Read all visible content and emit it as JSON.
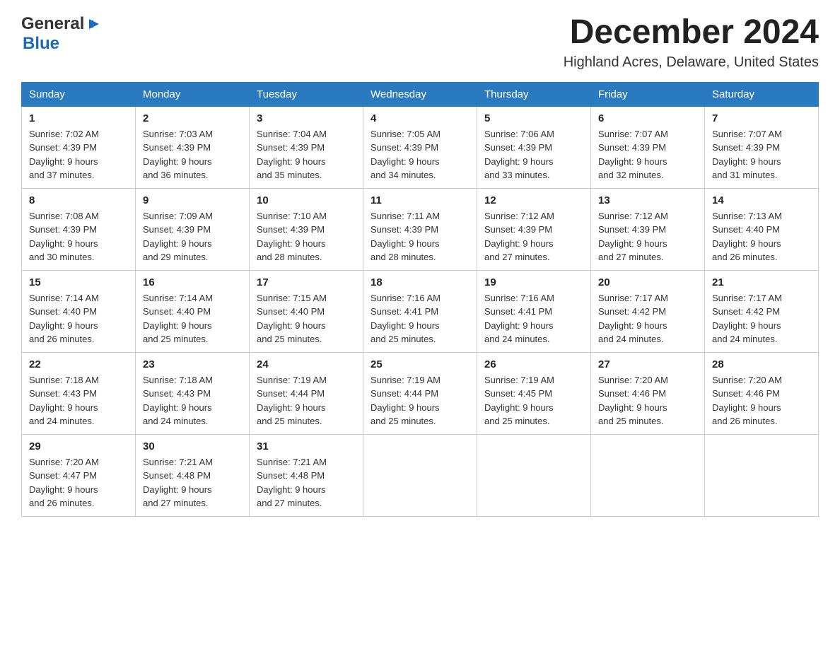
{
  "logo": {
    "general": "General",
    "blue": "Blue"
  },
  "title": "December 2024",
  "location": "Highland Acres, Delaware, United States",
  "weekdays": [
    "Sunday",
    "Monday",
    "Tuesday",
    "Wednesday",
    "Thursday",
    "Friday",
    "Saturday"
  ],
  "weeks": [
    [
      {
        "day": "1",
        "sunrise": "7:02 AM",
        "sunset": "4:39 PM",
        "daylight": "9 hours and 37 minutes."
      },
      {
        "day": "2",
        "sunrise": "7:03 AM",
        "sunset": "4:39 PM",
        "daylight": "9 hours and 36 minutes."
      },
      {
        "day": "3",
        "sunrise": "7:04 AM",
        "sunset": "4:39 PM",
        "daylight": "9 hours and 35 minutes."
      },
      {
        "day": "4",
        "sunrise": "7:05 AM",
        "sunset": "4:39 PM",
        "daylight": "9 hours and 34 minutes."
      },
      {
        "day": "5",
        "sunrise": "7:06 AM",
        "sunset": "4:39 PM",
        "daylight": "9 hours and 33 minutes."
      },
      {
        "day": "6",
        "sunrise": "7:07 AM",
        "sunset": "4:39 PM",
        "daylight": "9 hours and 32 minutes."
      },
      {
        "day": "7",
        "sunrise": "7:07 AM",
        "sunset": "4:39 PM",
        "daylight": "9 hours and 31 minutes."
      }
    ],
    [
      {
        "day": "8",
        "sunrise": "7:08 AM",
        "sunset": "4:39 PM",
        "daylight": "9 hours and 30 minutes."
      },
      {
        "day": "9",
        "sunrise": "7:09 AM",
        "sunset": "4:39 PM",
        "daylight": "9 hours and 29 minutes."
      },
      {
        "day": "10",
        "sunrise": "7:10 AM",
        "sunset": "4:39 PM",
        "daylight": "9 hours and 28 minutes."
      },
      {
        "day": "11",
        "sunrise": "7:11 AM",
        "sunset": "4:39 PM",
        "daylight": "9 hours and 28 minutes."
      },
      {
        "day": "12",
        "sunrise": "7:12 AM",
        "sunset": "4:39 PM",
        "daylight": "9 hours and 27 minutes."
      },
      {
        "day": "13",
        "sunrise": "7:12 AM",
        "sunset": "4:39 PM",
        "daylight": "9 hours and 27 minutes."
      },
      {
        "day": "14",
        "sunrise": "7:13 AM",
        "sunset": "4:40 PM",
        "daylight": "9 hours and 26 minutes."
      }
    ],
    [
      {
        "day": "15",
        "sunrise": "7:14 AM",
        "sunset": "4:40 PM",
        "daylight": "9 hours and 26 minutes."
      },
      {
        "day": "16",
        "sunrise": "7:14 AM",
        "sunset": "4:40 PM",
        "daylight": "9 hours and 25 minutes."
      },
      {
        "day": "17",
        "sunrise": "7:15 AM",
        "sunset": "4:40 PM",
        "daylight": "9 hours and 25 minutes."
      },
      {
        "day": "18",
        "sunrise": "7:16 AM",
        "sunset": "4:41 PM",
        "daylight": "9 hours and 25 minutes."
      },
      {
        "day": "19",
        "sunrise": "7:16 AM",
        "sunset": "4:41 PM",
        "daylight": "9 hours and 24 minutes."
      },
      {
        "day": "20",
        "sunrise": "7:17 AM",
        "sunset": "4:42 PM",
        "daylight": "9 hours and 24 minutes."
      },
      {
        "day": "21",
        "sunrise": "7:17 AM",
        "sunset": "4:42 PM",
        "daylight": "9 hours and 24 minutes."
      }
    ],
    [
      {
        "day": "22",
        "sunrise": "7:18 AM",
        "sunset": "4:43 PM",
        "daylight": "9 hours and 24 minutes."
      },
      {
        "day": "23",
        "sunrise": "7:18 AM",
        "sunset": "4:43 PM",
        "daylight": "9 hours and 24 minutes."
      },
      {
        "day": "24",
        "sunrise": "7:19 AM",
        "sunset": "4:44 PM",
        "daylight": "9 hours and 25 minutes."
      },
      {
        "day": "25",
        "sunrise": "7:19 AM",
        "sunset": "4:44 PM",
        "daylight": "9 hours and 25 minutes."
      },
      {
        "day": "26",
        "sunrise": "7:19 AM",
        "sunset": "4:45 PM",
        "daylight": "9 hours and 25 minutes."
      },
      {
        "day": "27",
        "sunrise": "7:20 AM",
        "sunset": "4:46 PM",
        "daylight": "9 hours and 25 minutes."
      },
      {
        "day": "28",
        "sunrise": "7:20 AM",
        "sunset": "4:46 PM",
        "daylight": "9 hours and 26 minutes."
      }
    ],
    [
      {
        "day": "29",
        "sunrise": "7:20 AM",
        "sunset": "4:47 PM",
        "daylight": "9 hours and 26 minutes."
      },
      {
        "day": "30",
        "sunrise": "7:21 AM",
        "sunset": "4:48 PM",
        "daylight": "9 hours and 27 minutes."
      },
      {
        "day": "31",
        "sunrise": "7:21 AM",
        "sunset": "4:48 PM",
        "daylight": "9 hours and 27 minutes."
      },
      null,
      null,
      null,
      null
    ]
  ],
  "labels": {
    "sunrise": "Sunrise:",
    "sunset": "Sunset:",
    "daylight": "Daylight:"
  }
}
